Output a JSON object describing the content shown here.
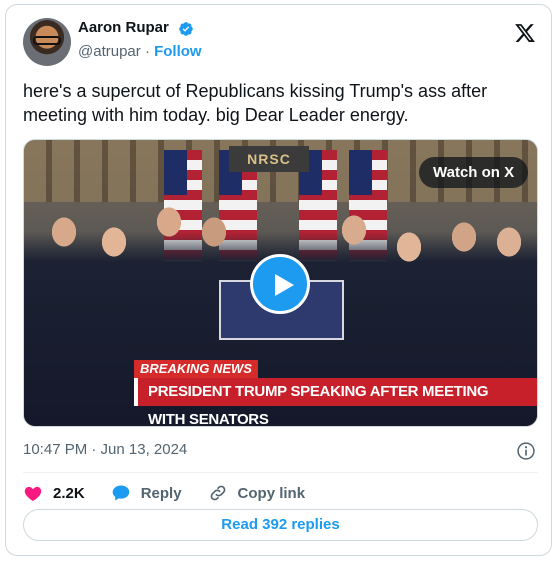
{
  "author": {
    "name": "Aaron Rupar",
    "handle": "@atrupar",
    "separator": "·",
    "follow_label": "Follow"
  },
  "tweet": {
    "text": "here's a supercut of Republicans kissing Trump's ass after meeting with him today. big Dear Leader energy."
  },
  "media": {
    "watch_label": "Watch on X",
    "breaking_label": "BREAKING NEWS",
    "chyron_text": "PRESIDENT TRUMP SPEAKING AFTER MEETING WITH SENATORS",
    "sign_text": "NRSC"
  },
  "meta": {
    "timestamp": "10:47 PM · Jun 13, 2024"
  },
  "actions": {
    "likes_count": "2.2K",
    "reply_label": "Reply",
    "copy_label": "Copy link"
  },
  "footer": {
    "read_replies_label": "Read 392 replies"
  },
  "icons": {
    "verified": "verified-badge-icon",
    "logo": "x-logo-icon",
    "play": "play-icon",
    "info": "info-icon",
    "like": "heart-icon",
    "reply": "speech-bubble-icon",
    "copy": "link-icon"
  },
  "colors": {
    "accent": "#1d9bf0",
    "like": "#f91880",
    "secondary_text": "#536471",
    "breaking_red": "#c8202a"
  }
}
